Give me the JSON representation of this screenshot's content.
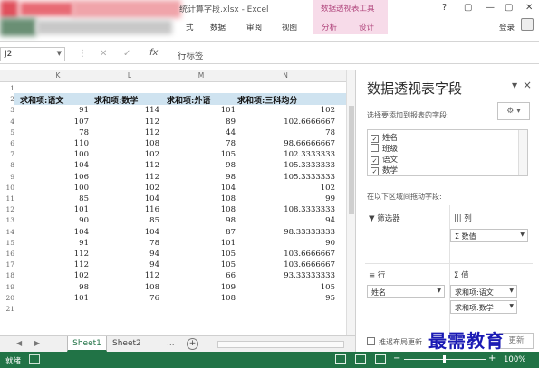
{
  "window": {
    "title": "统计算字段.xlsx - Excel",
    "contextual_group": "数据透视表工具",
    "controls": [
      "?",
      "▢",
      "—",
      "▢",
      "✕"
    ],
    "login": "登录"
  },
  "ribbon_tabs": [
    {
      "label": "式",
      "contextual": false
    },
    {
      "label": "数据",
      "contextual": false
    },
    {
      "label": "审阅",
      "contextual": false
    },
    {
      "label": "视图",
      "contextual": false
    },
    {
      "label": "分析",
      "contextual": true
    },
    {
      "label": "设计",
      "contextual": true
    }
  ],
  "formula_bar": {
    "name_box": "J2",
    "fx": "fx",
    "value": "行标签"
  },
  "grid": {
    "columns": [
      "K",
      "L",
      "M",
      "N"
    ],
    "row_numbers": [
      "1",
      "2",
      "3",
      "4",
      "5",
      "6",
      "7",
      "8",
      "9",
      "10",
      "11",
      "12",
      "13",
      "14",
      "15",
      "16",
      "17",
      "18",
      "19",
      "20",
      "21"
    ],
    "headers": [
      "求和项:语文",
      "求和项:数学",
      "求和项:外语",
      "求和项:三科均分"
    ],
    "rows": [
      [
        "91",
        "114",
        "101",
        "102"
      ],
      [
        "107",
        "112",
        "89",
        "102.6666667"
      ],
      [
        "78",
        "112",
        "44",
        "78"
      ],
      [
        "110",
        "108",
        "78",
        "98.66666667"
      ],
      [
        "100",
        "102",
        "105",
        "102.3333333"
      ],
      [
        "104",
        "112",
        "98",
        "105.3333333"
      ],
      [
        "106",
        "112",
        "98",
        "105.3333333"
      ],
      [
        "100",
        "102",
        "104",
        "102"
      ],
      [
        "85",
        "104",
        "108",
        "99"
      ],
      [
        "101",
        "116",
        "108",
        "108.3333333"
      ],
      [
        "90",
        "85",
        "98",
        "94"
      ],
      [
        "104",
        "104",
        "87",
        "98.33333333"
      ],
      [
        "91",
        "78",
        "101",
        "90"
      ],
      [
        "112",
        "94",
        "105",
        "103.6666667"
      ],
      [
        "112",
        "94",
        "105",
        "103.6666667"
      ],
      [
        "102",
        "112",
        "66",
        "93.33333333"
      ],
      [
        "98",
        "108",
        "109",
        "105"
      ],
      [
        "101",
        "76",
        "108",
        "95"
      ]
    ]
  },
  "sheets": {
    "tabs": [
      "Sheet1",
      "Sheet2"
    ],
    "active": "Sheet1",
    "more": "...",
    "add": "+"
  },
  "status": {
    "ready": "就绪",
    "zoom": "100%",
    "zoom_minus": "−",
    "zoom_plus": "+"
  },
  "pivot_panel": {
    "title": "数据透视表字段",
    "choose_label": "选择要添加到报表的字段:",
    "gear": "⚙ ▾",
    "fields": [
      {
        "name": "姓名",
        "checked": true
      },
      {
        "name": "班级",
        "checked": false
      },
      {
        "name": "语文",
        "checked": true
      },
      {
        "name": "数学",
        "checked": true
      }
    ],
    "drag_label": "在以下区域间拖动字段:",
    "zones": {
      "filters": {
        "label": "筛选器",
        "icon": "▼"
      },
      "columns": {
        "label": "列",
        "icon": "|||",
        "items": [
          "Σ 数值"
        ]
      },
      "rows": {
        "label": "行",
        "icon": "≡",
        "items": [
          "姓名"
        ]
      },
      "values": {
        "label": "值",
        "icon": "Σ",
        "items": [
          "求和项:语文",
          "求和项:数学"
        ]
      }
    },
    "defer_label": "推迟布局更新",
    "update_button": "更新"
  },
  "watermark": "最需教育",
  "colors": {
    "excel_green": "#217346",
    "contextual_pink": "#f7dbe9",
    "header_row": "#cfe3f0",
    "watermark": "#1a1ab4"
  }
}
